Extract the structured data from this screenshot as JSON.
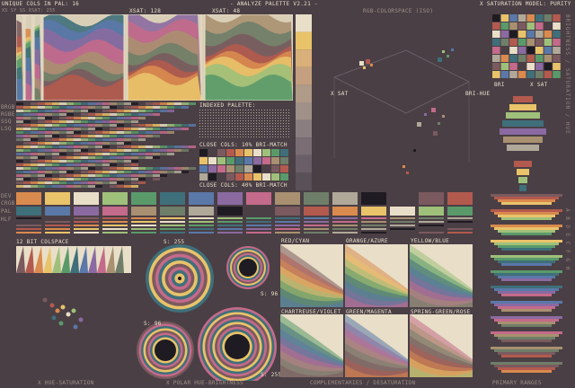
{
  "header": {
    "left": "UNIQUE COLS IN PAL: 16",
    "sub": "XS SY SS XSAT: 255",
    "xsat": "XSAT: 128",
    "xsat2": "XSAT: 48",
    "title": "- ANALYZE PALETTE V2.21 -",
    "space": "RGB-COLORSPACE (ISO)",
    "model": "X SATURATION MODEL: PURITY"
  },
  "left_labels": [
    "BRGB",
    "RGBE",
    "SSQ",
    "LSQ"
  ],
  "row_labels": [
    "DEV",
    "CRGB",
    "PAL",
    "HLF"
  ],
  "indexed": {
    "title": "INDEXED PALETTE:",
    "close10": "CLOSE COLS: 10% BRI-MATCH",
    "close40": "CLOSE COLS: 40% BRI-MATCH"
  },
  "space_labels": {
    "x_sat": "X SAT",
    "bri_hue": "BRI-HUE",
    "bri": "BRI",
    "x_sat2": "X SAT"
  },
  "colspace": {
    "title": "12 BIT COLSPACE"
  },
  "ring_labels": {
    "s1": "S: 255",
    "s2": "S: 96",
    "s3": "S: 96",
    "s4": "S: 255"
  },
  "comp_labels": [
    "RED/CYAN",
    "ORANGE/AZURE",
    "YELLOW/BLUE",
    "CHARTREUSE/VIOLET",
    "GREEN/MAGENTA",
    "SPRING-GREEN/ROSE"
  ],
  "footer": {
    "a": "X HUE-SATURATION",
    "b": "X POLAR HUE-BRIGHTNESS",
    "c": "COMPLEMENTARIES / DESATURATION",
    "d": "PRIMARY RANGES"
  },
  "side_text": {
    "right1": "BRIGHTNESS / SATURATION / HUE",
    "right2": "A B D E C F G H"
  },
  "palette": [
    "#1f1b22",
    "#4a3f45",
    "#7a5a5e",
    "#b35a4e",
    "#d98a4e",
    "#e9c36a",
    "#e9dfc8",
    "#9fc07a",
    "#5a9a6a",
    "#3f6f7a",
    "#5a78a8",
    "#8a6aa0",
    "#c46a8a",
    "#a89070",
    "#6f7e68",
    "#b0a898"
  ]
}
